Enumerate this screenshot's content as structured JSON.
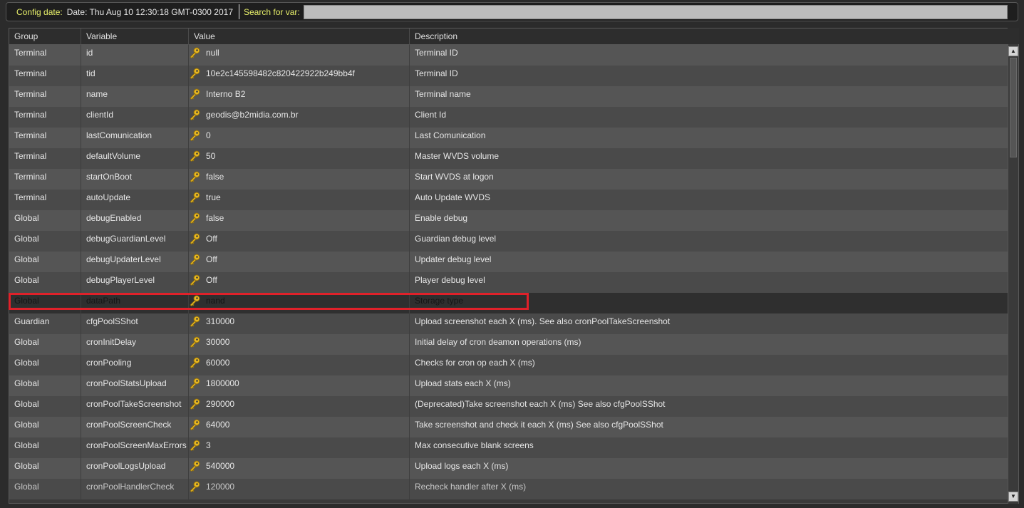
{
  "toolbar": {
    "config_label": "Config date:",
    "config_value": "Date: Thu Aug 10 12:30:18 GMT-0300 2017",
    "search_label": "Search for var:",
    "search_value": ""
  },
  "table": {
    "columns": [
      "Group",
      "Variable",
      "Value",
      "Description"
    ],
    "rows": [
      {
        "group": "Terminal",
        "variable": "id",
        "value": "null",
        "description": "Terminal ID"
      },
      {
        "group": "Terminal",
        "variable": "tid",
        "value": "10e2c145598482c820422922b249bb4f",
        "description": "Terminal ID"
      },
      {
        "group": "Terminal",
        "variable": "name",
        "value": "Interno B2",
        "description": "Terminal name"
      },
      {
        "group": "Terminal",
        "variable": "clientId",
        "value": "geodis@b2midia.com.br",
        "description": "Client Id"
      },
      {
        "group": "Terminal",
        "variable": "lastComunication",
        "value": "0",
        "description": "Last Comunication"
      },
      {
        "group": "Terminal",
        "variable": "defaultVolume",
        "value": "50",
        "description": "Master WVDS volume"
      },
      {
        "group": "Terminal",
        "variable": "startOnBoot",
        "value": "false",
        "description": "Start WVDS at logon"
      },
      {
        "group": "Terminal",
        "variable": "autoUpdate",
        "value": "true",
        "description": "Auto Update WVDS"
      },
      {
        "group": "Global",
        "variable": "debugEnabled",
        "value": "false",
        "description": "Enable debug"
      },
      {
        "group": "Global",
        "variable": "debugGuardianLevel",
        "value": "Off",
        "description": "Guardian debug level"
      },
      {
        "group": "Global",
        "variable": "debugUpdaterLevel",
        "value": "Off",
        "description": "Updater debug level"
      },
      {
        "group": "Global",
        "variable": "debugPlayerLevel",
        "value": "Off",
        "description": "Player debug level"
      },
      {
        "group": "Global",
        "variable": "dataPath",
        "value": "nand",
        "description": "Storage type",
        "selected": true
      },
      {
        "group": "Guardian",
        "variable": "cfgPoolSShot",
        "value": "310000",
        "description": "Upload screenshot each X (ms). See also cronPoolTakeScreenshot"
      },
      {
        "group": "Global",
        "variable": "cronInitDelay",
        "value": "30000",
        "description": "Initial delay of cron deamon operations (ms)"
      },
      {
        "group": "Global",
        "variable": "cronPooling",
        "value": "60000",
        "description": "Checks for cron op each X (ms)"
      },
      {
        "group": "Global",
        "variable": "cronPoolStatsUpload",
        "value": "1800000",
        "description": "Upload stats each X (ms)"
      },
      {
        "group": "Global",
        "variable": "cronPoolTakeScreenshot",
        "value": "290000",
        "description": "(Deprecated)Take screenshot each X (ms) See also cfgPoolSShot"
      },
      {
        "group": "Global",
        "variable": "cronPoolScreenCheck",
        "value": "64000",
        "description": "Take screenshot and check it each X (ms) See also cfgPoolSShot"
      },
      {
        "group": "Global",
        "variable": "cronPoolScreenMaxErrors",
        "value": "3",
        "description": "Max consecutive blank screens"
      },
      {
        "group": "Global",
        "variable": "cronPoolLogsUpload",
        "value": "540000",
        "description": "Upload logs each X (ms)"
      },
      {
        "group": "Global",
        "variable": "cronPoolHandlerCheck",
        "value": "120000",
        "description": "Recheck handler after X (ms)"
      }
    ]
  },
  "colors": {
    "label_yellow": "#e8f06a",
    "highlight_red": "#e0212a",
    "key_gold": "#e8b820"
  }
}
